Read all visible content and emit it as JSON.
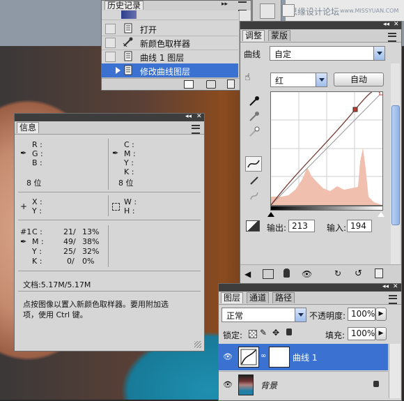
{
  "watermark": {
    "title": "思缘设计论坛",
    "url": "www.MISSYUAN.COM"
  },
  "history": {
    "title": "历史记录",
    "items": [
      {
        "label": "打开"
      },
      {
        "label": "新颜色取样器"
      },
      {
        "label": "曲线 1 图层"
      },
      {
        "label": "修改曲线图层"
      }
    ],
    "selected_index": 3
  },
  "adjustments": {
    "tabs": [
      {
        "label": "调整"
      },
      {
        "label": "蒙版"
      }
    ],
    "preset_label": "曲线",
    "preset_value": "自定",
    "channel_value": "红",
    "auto_label": "自动",
    "output_label": "输出:",
    "output_value": "213",
    "input_label": "输入:",
    "input_value": "194"
  },
  "info": {
    "title": "信息",
    "rgb_labels": [
      "R :",
      "G :",
      "B :"
    ],
    "cmyk_labels": [
      "C :",
      "M :",
      "Y :",
      "K :"
    ],
    "bit_left": "8 位",
    "bit_right": "8 位",
    "xy_labels": [
      "X :",
      "Y :"
    ],
    "wh_labels": [
      "W :",
      "H :"
    ],
    "sampler": {
      "id": "#1",
      "rows": [
        {
          "label": "C :",
          "a": "21/",
          "b": "13%"
        },
        {
          "label": "M :",
          "a": "49/",
          "b": "38%"
        },
        {
          "label": "Y :",
          "a": "25/",
          "b": "32%"
        },
        {
          "label": "K :",
          "a": "0/",
          "b": "0%"
        }
      ]
    },
    "doc": "文档:5.17M/5.17M",
    "hint_line1": "点按图像以置入新颜色取样器。要用附加选",
    "hint_line2": "项，使用 Ctrl 键。"
  },
  "layers": {
    "tabs": [
      {
        "label": "图层"
      },
      {
        "label": "通道"
      },
      {
        "label": "路径"
      }
    ],
    "blend_mode": "正常",
    "opacity_label": "不透明度:",
    "opacity_value": "100%",
    "lock_label": "锁定:",
    "fill_label": "填充:",
    "fill_value": "100%",
    "items": [
      {
        "name": "曲线 1"
      },
      {
        "name": "背景"
      }
    ]
  },
  "colors": {
    "selection": "#3b72d2",
    "curve_point": "#c0392b",
    "histogram": "#f1bfae"
  }
}
